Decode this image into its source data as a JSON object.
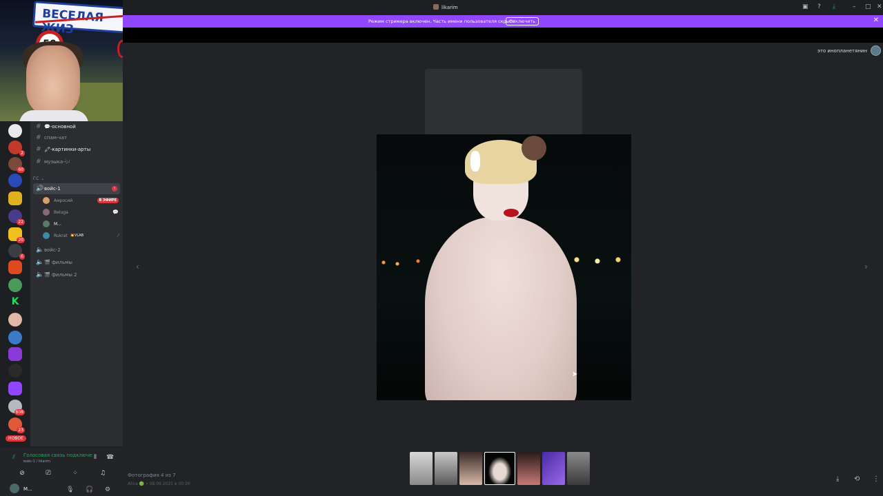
{
  "window": {
    "title": "likarim"
  },
  "banner": {
    "message": "Режим стримера включен. Часть имени пользователя скрыта.",
    "button": "Отключить"
  },
  "webcam": {
    "sign_text": "ВЕСЕЛАЯ ЖИЗ",
    "speed": "50"
  },
  "channels": {
    "text": [
      {
        "label": "💬-основной"
      },
      {
        "label": "спам-чат"
      },
      {
        "label": "🖍-картинки-арты"
      },
      {
        "label": "музыка-🎶"
      }
    ],
    "category": "ГС",
    "voice1": {
      "label": "войс-1",
      "badge": "!"
    },
    "voice_users": [
      {
        "name": "Амросий",
        "live": "В ЭФИРЕ"
      },
      {
        "name": "Beluga"
      },
      {
        "name": "М..."
      },
      {
        "name": "Rukrat",
        "tag": "💥VLAB"
      }
    ],
    "other_voice": [
      {
        "label": "войс-2"
      },
      {
        "label": "🎬 фильмы"
      },
      {
        "label": "🎬 фильмы 2"
      }
    ]
  },
  "rail": {
    "new_label": "НОВОЕ",
    "badges": [
      "2",
      "60",
      "22",
      "20",
      "6",
      "808",
      "23"
    ]
  },
  "voice_panel": {
    "status": "Голосовая связь подключена",
    "channel": "войс-1 / likarim"
  },
  "user_area": {
    "name": "М..."
  },
  "viewer": {
    "top_right_user": "это инопланетянин",
    "caption": "Фотография 4 из 7",
    "sub_caption": "Alina 🟢 • 08.09.2025 в 00:30"
  },
  "colors": {
    "accent": "#9146ff",
    "online": "#23a55a",
    "danger": "#da373c"
  }
}
